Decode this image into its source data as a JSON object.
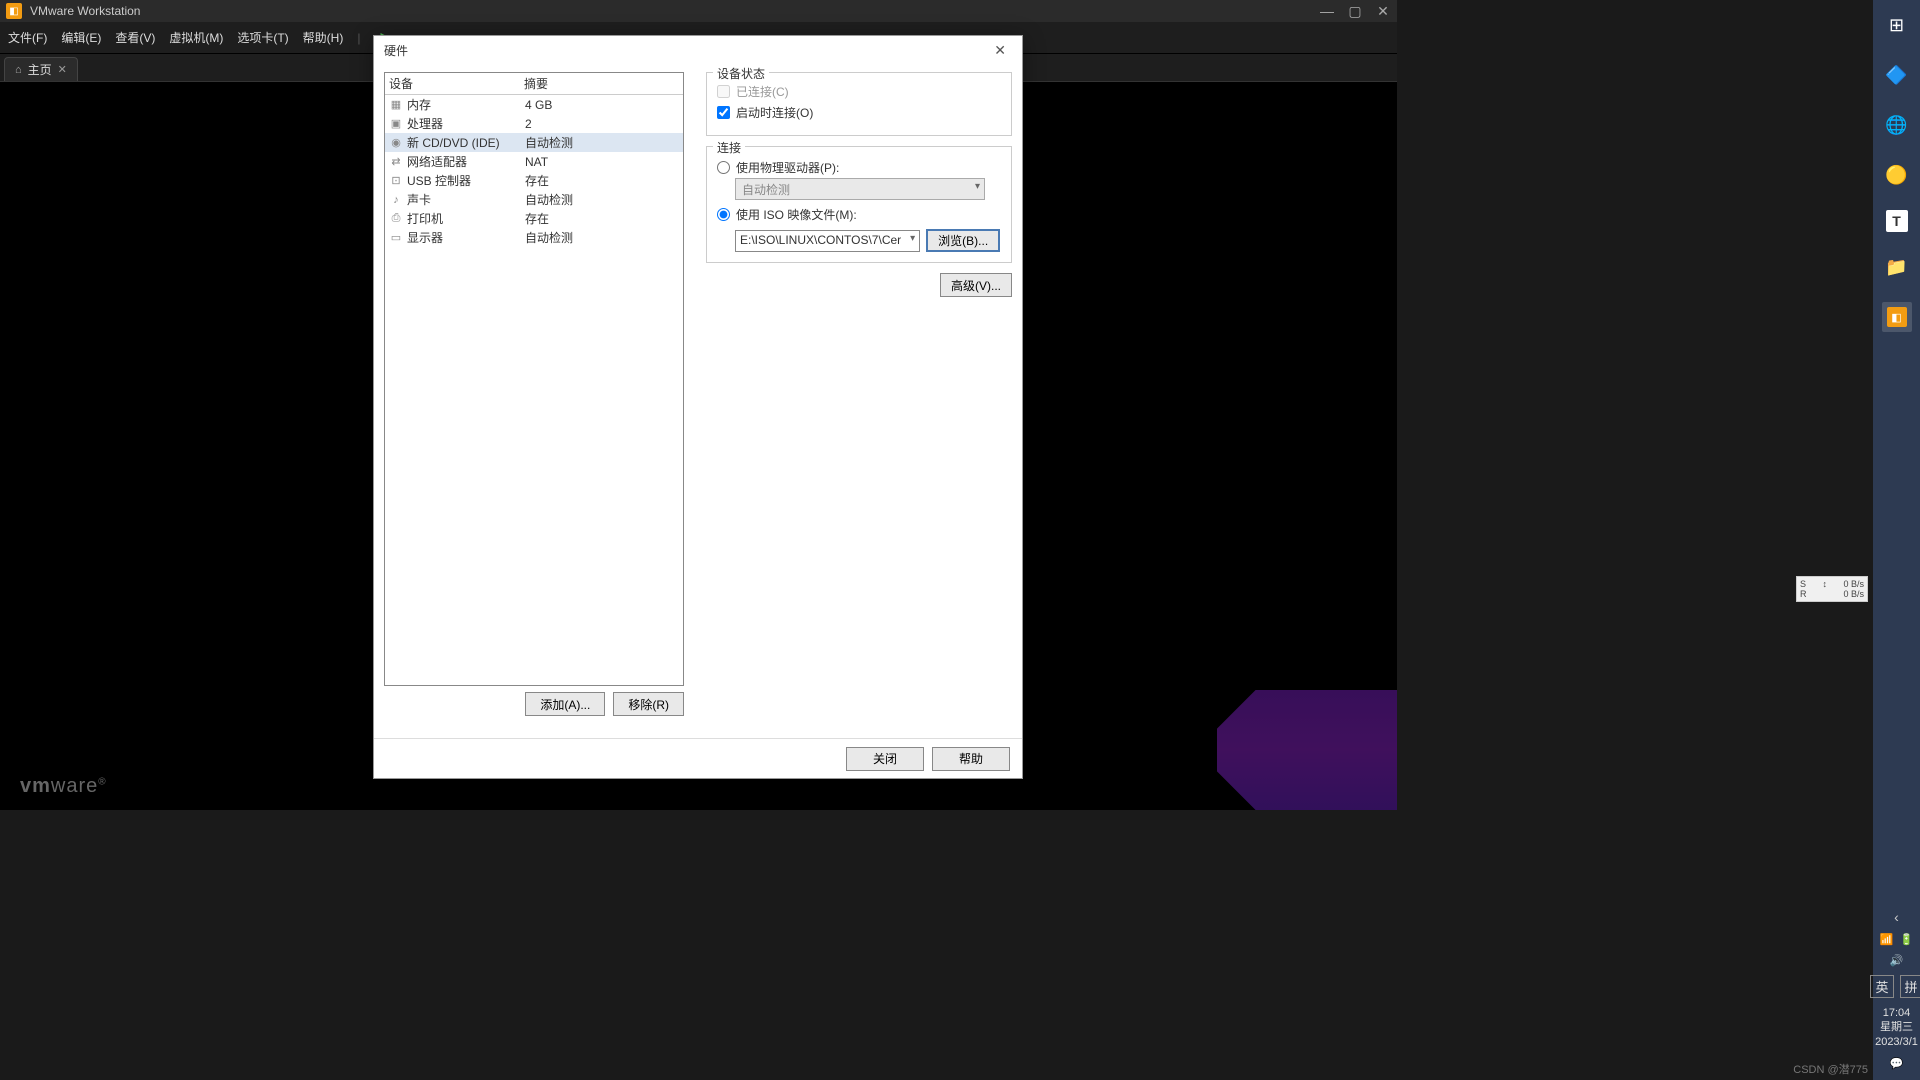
{
  "app": {
    "title": "VMware Workstation",
    "logo_html": "vmware"
  },
  "titlebar": {
    "minimize": "—",
    "maximize": "▢",
    "close": "✕"
  },
  "menubar": {
    "file": "文件(F)",
    "edit": "编辑(E)",
    "view": "查看(V)",
    "vm": "虚拟机(M)",
    "tabs": "选项卡(T)",
    "help": "帮助(H)"
  },
  "tab": {
    "home": "主页"
  },
  "dialog": {
    "title": "硬件",
    "devices_header": {
      "device": "设备",
      "summary": "摘要"
    },
    "devices": [
      {
        "icon": "▦",
        "name": "内存",
        "summary": "4 GB"
      },
      {
        "icon": "▣",
        "name": "处理器",
        "summary": "2"
      },
      {
        "icon": "◉",
        "name": "新 CD/DVD (IDE)",
        "summary": "自动检测",
        "selected": true
      },
      {
        "icon": "⇄",
        "name": "网络适配器",
        "summary": "NAT"
      },
      {
        "icon": "⊡",
        "name": "USB 控制器",
        "summary": "存在"
      },
      {
        "icon": "♪",
        "name": "声卡",
        "summary": "自动检测"
      },
      {
        "icon": "⎙",
        "name": "打印机",
        "summary": "存在"
      },
      {
        "icon": "▭",
        "name": "显示器",
        "summary": "自动检测"
      }
    ],
    "status_group": "设备状态",
    "connected": "已连接(C)",
    "connect_on_start": "启动时连接(O)",
    "connection_group": "连接",
    "use_physical": "使用物理驱动器(P):",
    "auto_detect": "自动检测",
    "use_iso": "使用 ISO 映像文件(M):",
    "iso_path": "E:\\ISO\\LINUX\\CONTOS\\7\\Cer",
    "browse": "浏览(B)...",
    "advanced": "高级(V)...",
    "add": "添加(A)...",
    "remove": "移除(R)",
    "close": "关闭",
    "help": "帮助"
  },
  "taskbar": {
    "chevron": "‹",
    "ime_lang": "英",
    "ime_mode": "拼",
    "time": "17:04",
    "weekday": "星期三",
    "date": "2023/3/1"
  },
  "netspeed": {
    "s_label": "S",
    "r_label": "R",
    "s_val": "0 B/s",
    "r_val": "0 B/s",
    "arrow": "↕"
  },
  "watermark": "CSDN @潜775"
}
